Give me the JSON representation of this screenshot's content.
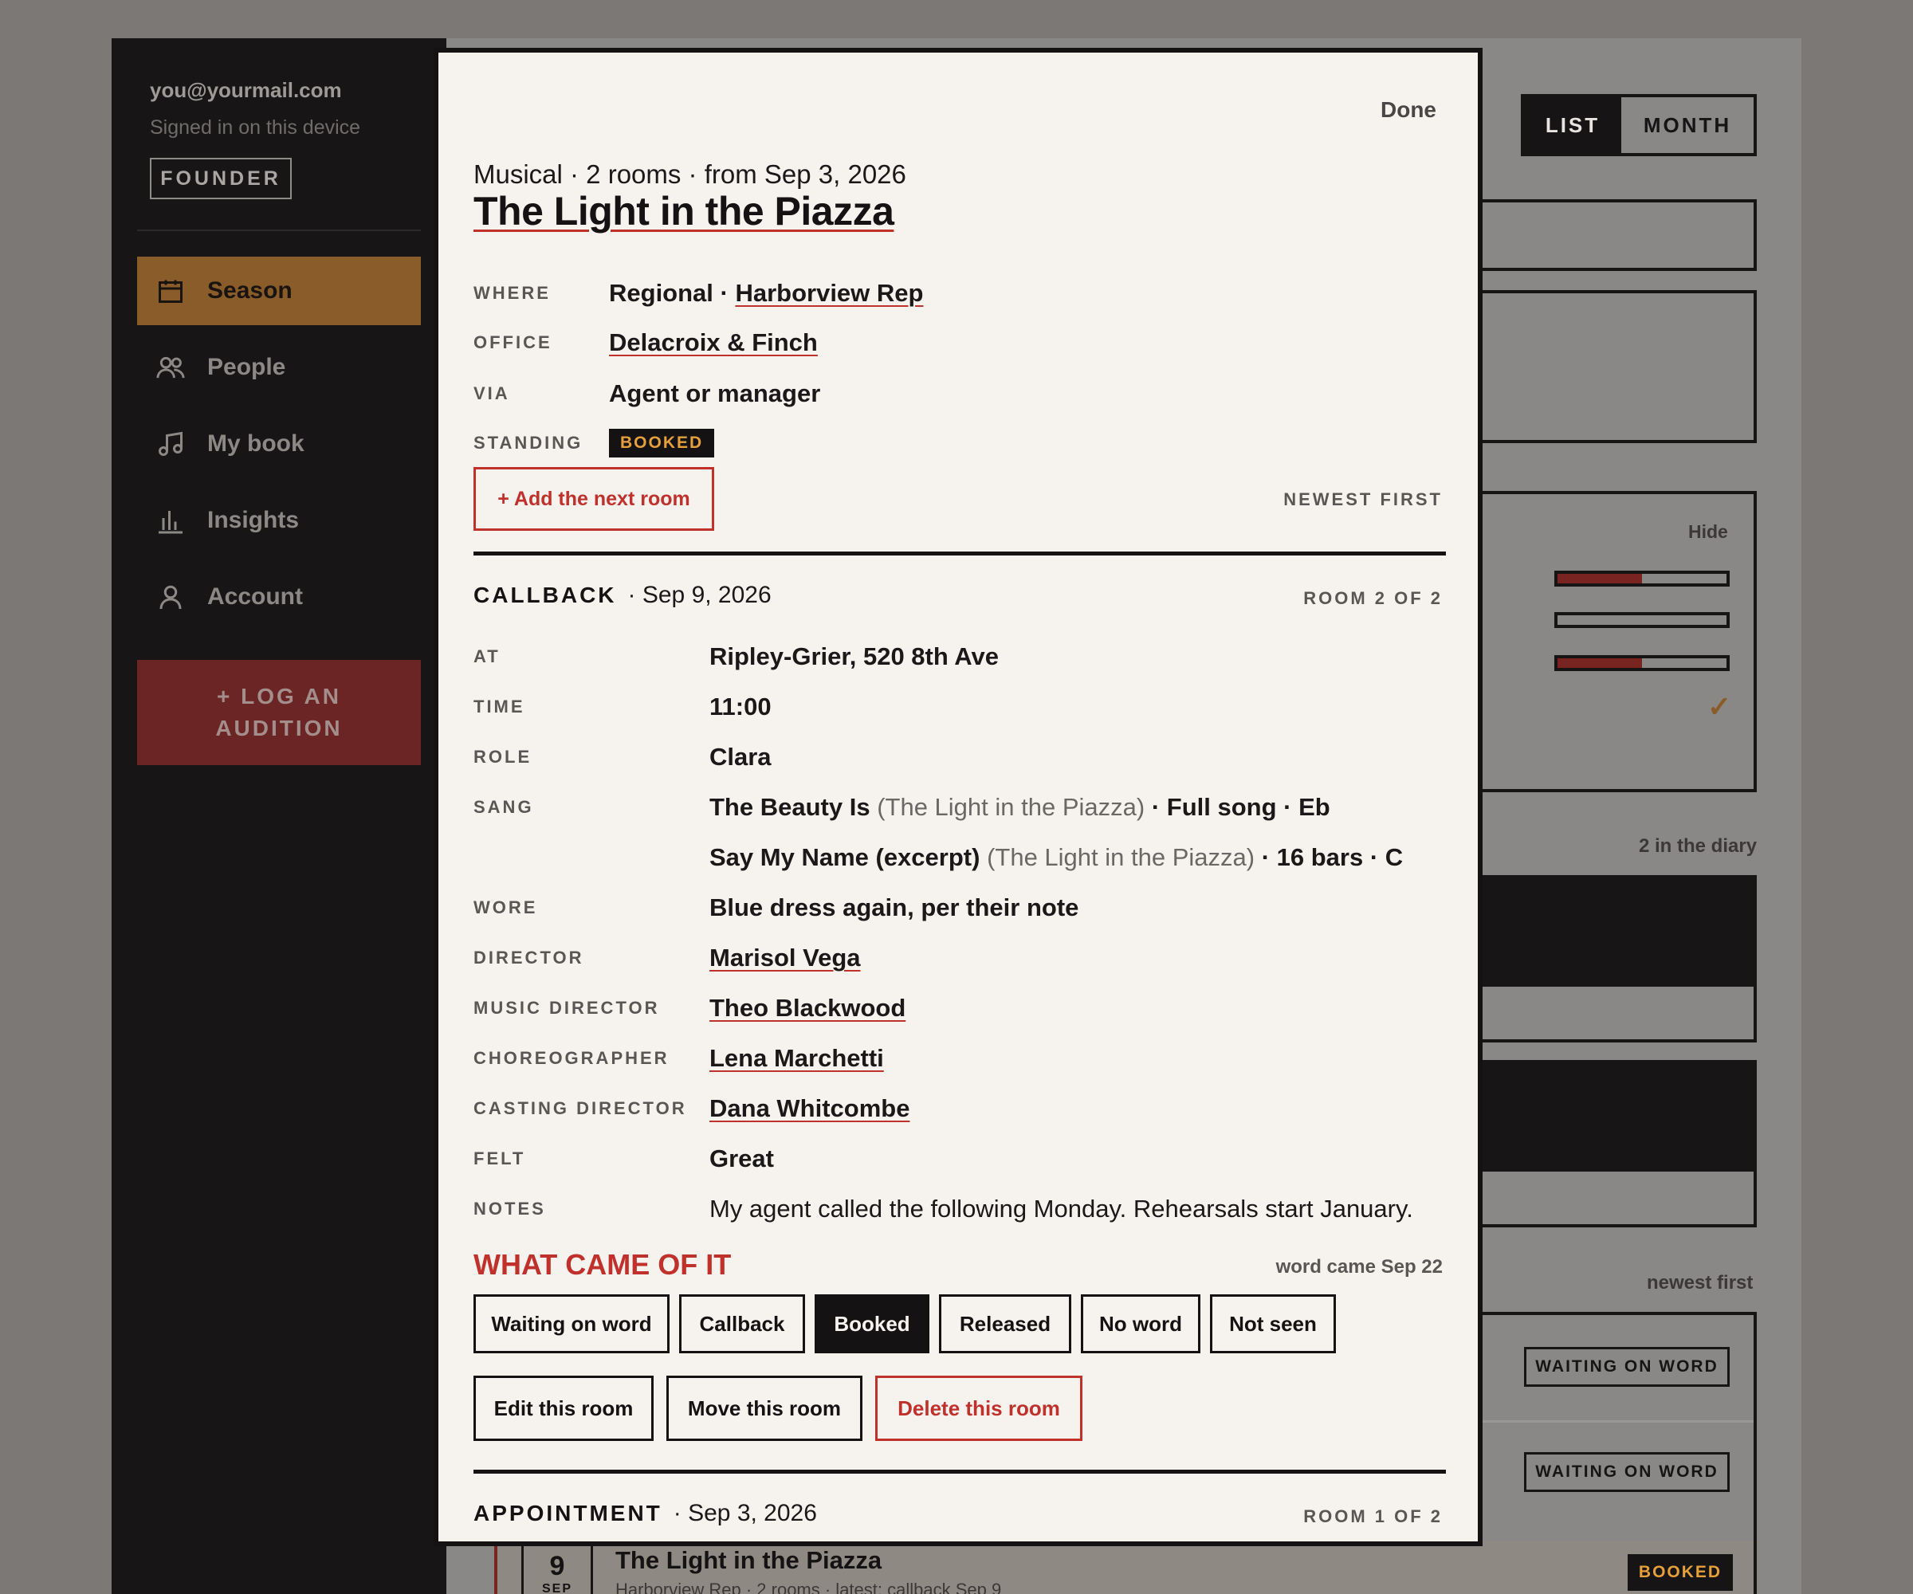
{
  "sidebar": {
    "email": "you@yourmail.com",
    "signed_in": "Signed in on this device",
    "badge": "FOUNDER",
    "nav": [
      {
        "label": "Season",
        "icon": "calendar-icon"
      },
      {
        "label": "People",
        "icon": "people-icon"
      },
      {
        "label": "My book",
        "icon": "music-note-icon"
      },
      {
        "label": "Insights",
        "icon": "bar-chart-icon"
      },
      {
        "label": "Account",
        "icon": "person-icon"
      }
    ],
    "log_button": "+ LOG AN AUDITION"
  },
  "background": {
    "view_toggle": {
      "list": "LIST",
      "month": "MONTH"
    },
    "hide": "Hide",
    "progress": [
      0.5,
      0.0,
      0.5
    ],
    "check": "✓",
    "diary_count": "2 in the diary",
    "sort": "newest first",
    "status_pills": [
      "WAITING ON WORD",
      "WAITING ON WORD"
    ],
    "card": {
      "day": "9",
      "month": "SEP",
      "title": "The Light in the Piazza",
      "subtitle": "Harborview Rep · 2 rooms · latest: callback Sep 9",
      "status": "BOOKED"
    }
  },
  "modal": {
    "done": "Done",
    "meta": "Musical · 2 rooms · from Sep 3, 2026",
    "title": "The Light in the Piazza",
    "fields": {
      "where_label": "WHERE",
      "where_prefix": "Regional · ",
      "where_link": "Harborview Rep",
      "office_label": "OFFICE",
      "office": "Delacroix & Finch",
      "via_label": "VIA",
      "via": "Agent or manager",
      "standing_label": "STANDING",
      "standing": "BOOKED"
    },
    "add_room": "+ Add the next room",
    "sort": "NEWEST FIRST",
    "room2": {
      "type": "CALLBACK",
      "date": "· Sep 9, 2026",
      "count": "ROOM 2 OF 2",
      "at_label": "AT",
      "at": "Ripley-Grier, 520 8th Ave",
      "time_label": "TIME",
      "time": "11:00",
      "role_label": "ROLE",
      "role": "Clara",
      "sang_label": "SANG",
      "songs": [
        {
          "title": "The Beauty Is",
          "show": "(The Light in the Piazza)",
          "detail": "· Full song · Eb"
        },
        {
          "title": "Say My Name (excerpt)",
          "show": "(The Light in the Piazza)",
          "detail": "· 16 bars · C"
        }
      ],
      "wore_label": "WORE",
      "wore": "Blue dress again, per their note",
      "director_label": "DIRECTOR",
      "director": "Marisol Vega",
      "md_label": "MUSIC DIRECTOR",
      "md": "Theo Blackwood",
      "choreo_label": "CHOREOGRAPHER",
      "choreo": "Lena Marchetti",
      "cd_label": "CASTING DIRECTOR",
      "cd": "Dana Whitcombe",
      "felt_label": "FELT",
      "felt": "Great",
      "notes_label": "NOTES",
      "notes": "My agent called the following Monday. Rehearsals start January."
    },
    "outcome": {
      "heading": "WHAT CAME OF IT",
      "word_came": "word came Sep 22",
      "options": [
        "Waiting on word",
        "Callback",
        "Booked",
        "Released",
        "No word",
        "Not seen"
      ],
      "selected": "Booked"
    },
    "actions": {
      "edit": "Edit this room",
      "move": "Move this room",
      "delete": "Delete this room"
    },
    "room1": {
      "type": "APPOINTMENT",
      "date": "· Sep 3, 2026",
      "count": "ROOM 1 OF 2"
    }
  },
  "colors": {
    "accent": "#c0312b",
    "brand_gold": "#8a5c2a",
    "ink": "#141213",
    "paper": "#f6f3ef",
    "booked_text": "#e5a03a"
  }
}
